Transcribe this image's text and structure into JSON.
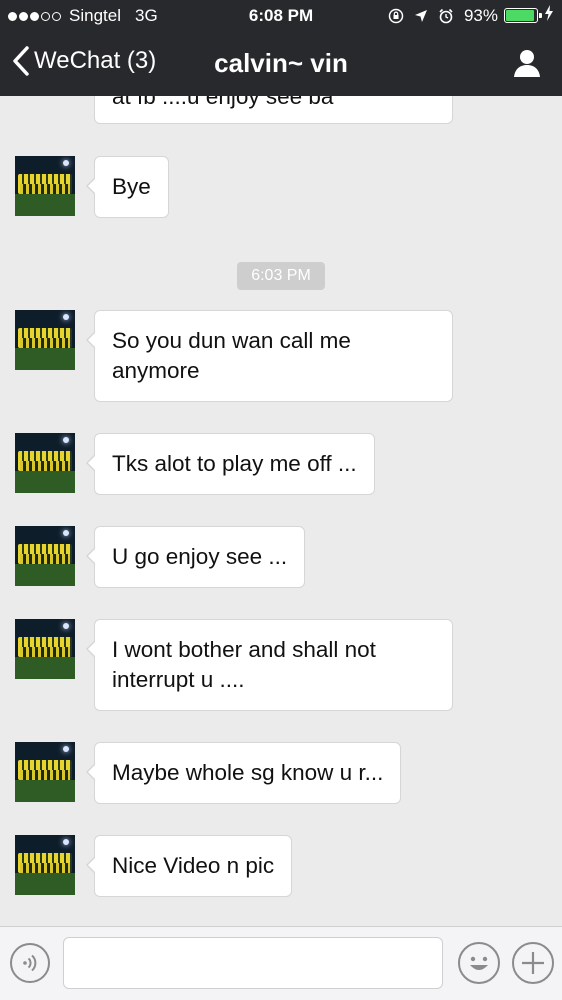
{
  "status_bar": {
    "carrier": "Singtel",
    "network": "3G",
    "time": "6:08 PM",
    "battery_percent": "93%",
    "battery_level": 0.93,
    "signal_bars_filled": 3,
    "signal_bars_total": 5,
    "icons": [
      "signal-dots-icon",
      "lock-rotation-icon",
      "location-arrow-icon",
      "alarm-icon",
      "battery-icon",
      "charging-bolt-icon"
    ]
  },
  "nav": {
    "back_label": "WeChat (3)",
    "title": "calvin~ vin",
    "profile_icon": "person-icon"
  },
  "messages": [
    {
      "text": "at fb ....u enjoy see ba"
    },
    {
      "text": "Bye"
    },
    {
      "text": "So you dun wan call me anymore"
    },
    {
      "text": "Tks alot to play me off ..."
    },
    {
      "text": "U go enjoy see ..."
    },
    {
      "text": "I wont bother and shall not interrupt u ...."
    },
    {
      "text": "Maybe whole sg know u r..."
    },
    {
      "text": "Nice Video n pic"
    }
  ],
  "timestamp": "6:03 PM",
  "input_bar": {
    "value": "",
    "icons": [
      "voice-icon",
      "emoji-icon",
      "plus-icon"
    ]
  },
  "colors": {
    "header_bg": "#28292d",
    "chat_bg": "#ebebeb",
    "battery_green": "#4cd964"
  }
}
